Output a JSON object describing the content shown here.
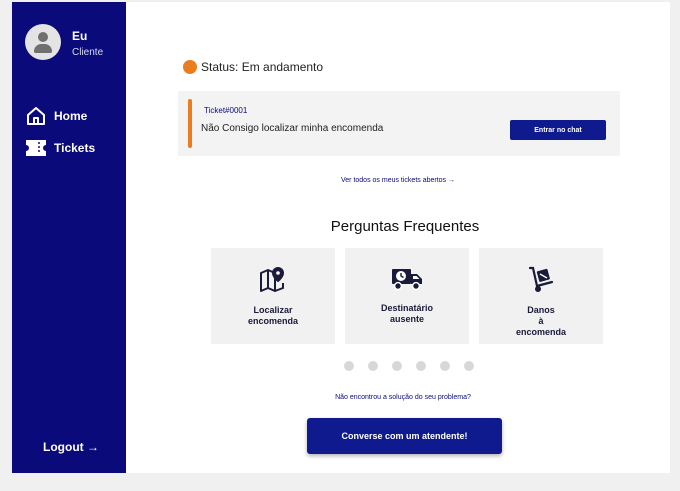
{
  "user": {
    "name": "Eu",
    "role": "Cliente"
  },
  "nav": {
    "home": "Home",
    "tickets": "Tickets",
    "logout": "Logout →"
  },
  "status": {
    "text": "Status: Em andamento",
    "color": "#e97d1f"
  },
  "ticket": {
    "id": "Ticket#0001",
    "subject": "Não Consigo localizar minha encomenda",
    "chat_button": "Entrar no chat"
  },
  "see_all": "Ver todos os meus tickets abertos →",
  "faq": {
    "title": "Perguntas Frequentes",
    "cards": [
      {
        "label": "Localizar\nencomenda",
        "icon": "map-pin-icon"
      },
      {
        "label": "Destinatário\nausente",
        "icon": "delivery-truck-clock-icon"
      },
      {
        "label": "Danos\nà\nencomenda",
        "icon": "hand-truck-box-icon"
      }
    ],
    "page_count": 6
  },
  "help": {
    "question": "Não encontrou a solução do seu problema?",
    "button": "Converse com um atendente!"
  },
  "colors": {
    "sidebar": "#0a0a7a",
    "accent": "#e97d1f",
    "button": "#0f1a8e"
  }
}
